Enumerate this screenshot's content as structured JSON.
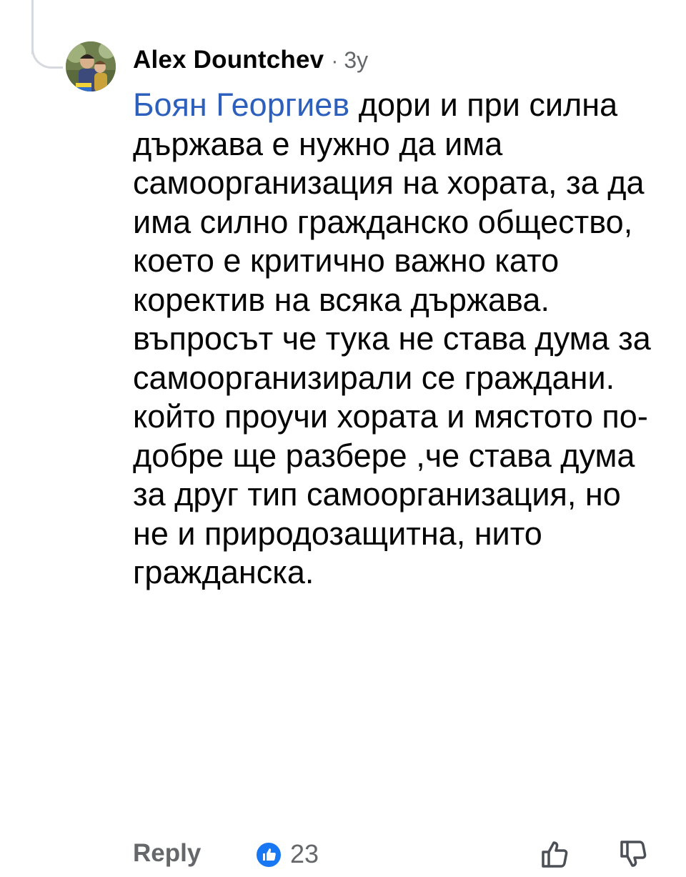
{
  "comment": {
    "author": "Alex Dountchev",
    "separator": "·",
    "time": "3y",
    "mention": "Боян Георгиев",
    "text": " дори и при силна държава е нужно да има самоорганизация на хората, за да има силно гражданско общество, което е критично важно като коректив на всяка държава. въпросът че тука не става дума за самоорганизирали се граждани. който проучи хората и мястото по-добре ще разбере ,че става дума за друг тип самоорганизация, но не и природозащитна, нито гражданска."
  },
  "footer": {
    "reply_label": "Reply",
    "reaction_count": "23",
    "reaction_icon": "like-icon",
    "upvote_icon": "thumbs-up-outline-icon",
    "downvote_icon": "thumbs-down-outline-icon"
  },
  "colors": {
    "mention": "#2d5fbd",
    "secondary_text": "#65676b",
    "like_blue": "#1877f2"
  }
}
